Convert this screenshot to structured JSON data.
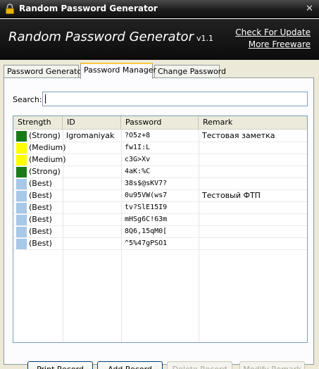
{
  "window": {
    "title": "Random Password Generator"
  },
  "header": {
    "app_name": "Random Password Generator",
    "version": "v1.1",
    "links": [
      "Check For Update",
      "More Freeware"
    ]
  },
  "tabs": [
    {
      "label": "Password Generator",
      "active": false
    },
    {
      "label": "Password Manager",
      "active": true
    },
    {
      "label": "Change Password",
      "active": false
    }
  ],
  "search": {
    "label": "Search:",
    "value": ""
  },
  "table": {
    "columns": [
      "Strength",
      "ID",
      "Password",
      "Remark"
    ],
    "strength_colors": {
      "Strong": "#1a7a1a",
      "Medium": "#ffff00",
      "Best": "#a8c8e8"
    },
    "rows": [
      {
        "strength": "(Strong)",
        "level": "Strong",
        "id": "Igromaniyak",
        "password": "?O5z+8",
        "remark": "Тестовая заметка"
      },
      {
        "strength": "(Medium)",
        "level": "Medium",
        "id": "",
        "password": "fw1I:L",
        "remark": ""
      },
      {
        "strength": "(Medium)",
        "level": "Medium",
        "id": "",
        "password": "c3G>Xv",
        "remark": ""
      },
      {
        "strength": "(Strong)",
        "level": "Strong",
        "id": "",
        "password": "4aK:%C",
        "remark": ""
      },
      {
        "strength": "(Best)",
        "level": "Best",
        "id": "",
        "password": "38s$@sKV7?",
        "remark": ""
      },
      {
        "strength": "(Best)",
        "level": "Best",
        "id": "",
        "password": "0u95VW(ws7",
        "remark": "Тестовый ФТП"
      },
      {
        "strength": "(Best)",
        "level": "Best",
        "id": "",
        "password": "tv?SlE15I9",
        "remark": ""
      },
      {
        "strength": "(Best)",
        "level": "Best",
        "id": "",
        "password": "mHSg6C!63m",
        "remark": ""
      },
      {
        "strength": "(Best)",
        "level": "Best",
        "id": "",
        "password": "8Q6,15qM0[",
        "remark": ""
      },
      {
        "strength": "(Best)",
        "level": "Best",
        "id": "",
        "password": "^5%47gPSO1",
        "remark": ""
      }
    ]
  },
  "buttons": [
    {
      "label": "Print Record",
      "enabled": true
    },
    {
      "label": "Add Record",
      "enabled": true
    },
    {
      "label": "Delete Record",
      "enabled": false
    },
    {
      "label": "Modify Remark",
      "enabled": false
    }
  ]
}
